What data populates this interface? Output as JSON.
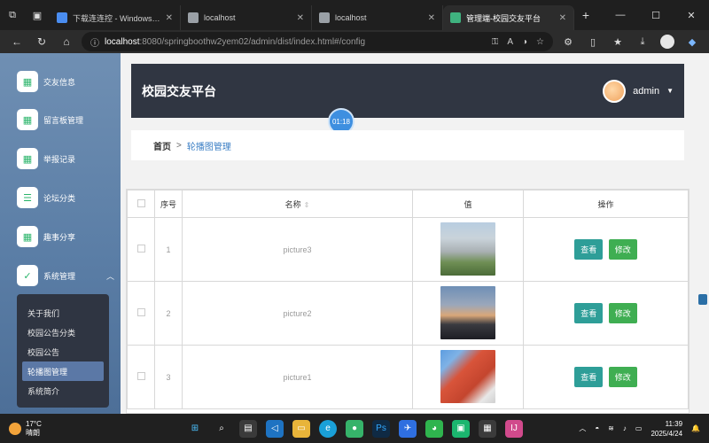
{
  "browser": {
    "tabs": [
      {
        "title": "下载连连控 - Windows、macOS、",
        "active": false,
        "favicon_color": "#4a8df0"
      },
      {
        "title": "localhost",
        "active": false,
        "favicon_color": "#9aa0a6"
      },
      {
        "title": "localhost",
        "active": false,
        "favicon_color": "#9aa0a6"
      },
      {
        "title": "管理端-校园交友平台",
        "active": true,
        "favicon_color": "#3fb27f"
      }
    ],
    "url_host": "localhost",
    "url_path": ":8080/springboothw2yem02/admin/dist/index.html#/config"
  },
  "sidebar": {
    "items": [
      {
        "label": "交友信息",
        "icon": "grid-icon"
      },
      {
        "label": "留言板管理",
        "icon": "grid-icon"
      },
      {
        "label": "举报记录",
        "icon": "grid-icon"
      },
      {
        "label": "论坛分类",
        "icon": "sliders-icon"
      },
      {
        "label": "趣事分享",
        "icon": "grid-icon"
      },
      {
        "label": "系统管理",
        "icon": "clipboard-icon"
      }
    ],
    "submenu": [
      {
        "label": "关于我们",
        "active": false
      },
      {
        "label": "校园公告分类",
        "active": false
      },
      {
        "label": "校园公告",
        "active": false
      },
      {
        "label": "轮播图管理",
        "active": true
      },
      {
        "label": "系统简介",
        "active": false
      }
    ]
  },
  "header": {
    "title": "校园交友平台",
    "user": "admin"
  },
  "timer": "01:18",
  "breadcrumb": {
    "home": "首页",
    "separator": ">",
    "current": "轮播图管理"
  },
  "table": {
    "columns": [
      "序号",
      "名称",
      "值",
      "操作"
    ],
    "rows": [
      {
        "index": "1",
        "name": "picture3",
        "image": "building-photo",
        "view": "查看",
        "edit": "修改"
      },
      {
        "index": "2",
        "name": "picture2",
        "image": "sunset-photo",
        "view": "查看",
        "edit": "修改"
      },
      {
        "index": "3",
        "name": "picture1",
        "image": "red-building-photo",
        "view": "查看",
        "edit": "修改"
      }
    ]
  },
  "taskbar": {
    "temperature": "17°C",
    "weather": "晴朗",
    "time": "11:39",
    "date": "2025/4/24"
  }
}
